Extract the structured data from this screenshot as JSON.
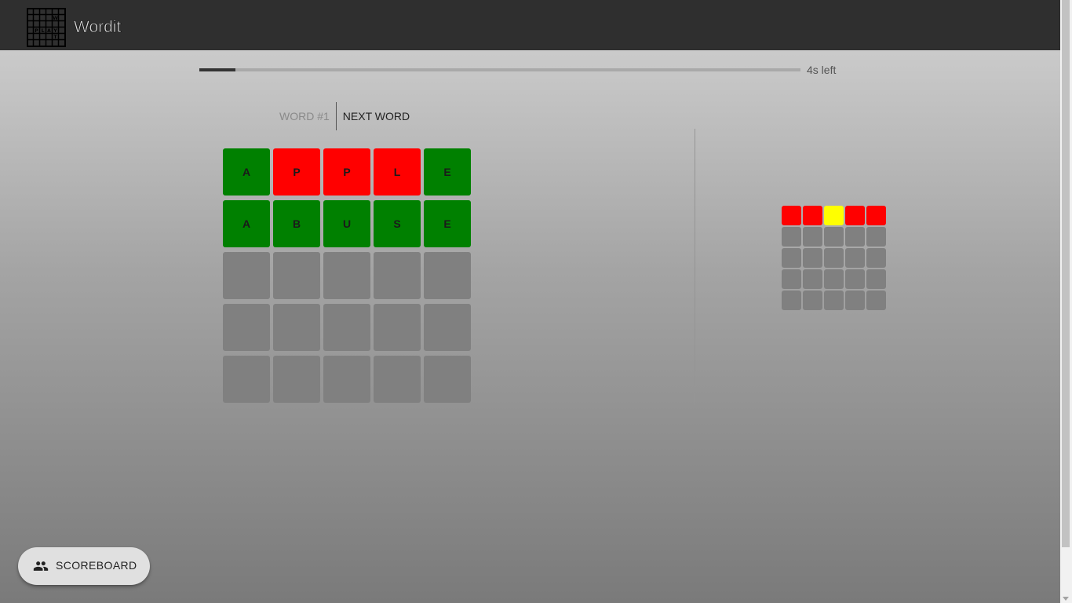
{
  "app": {
    "title": "Wordit",
    "logo_icon": "crossword-grid-logo-icon"
  },
  "timer": {
    "label": "4s left",
    "progress_fraction": 0.06
  },
  "tabs": {
    "current": "WORD #1",
    "next": "NEXT WORD"
  },
  "colors": {
    "green": "#008000",
    "red": "#ff0000",
    "yellow": "#ffff00",
    "gray": "#808080",
    "appbar": "#2f2f2f"
  },
  "board": {
    "rows": [
      [
        {
          "letter": "A",
          "state": "green"
        },
        {
          "letter": "P",
          "state": "red"
        },
        {
          "letter": "P",
          "state": "red"
        },
        {
          "letter": "L",
          "state": "red"
        },
        {
          "letter": "E",
          "state": "green"
        }
      ],
      [
        {
          "letter": "A",
          "state": "green"
        },
        {
          "letter": "B",
          "state": "green"
        },
        {
          "letter": "U",
          "state": "green"
        },
        {
          "letter": "S",
          "state": "green"
        },
        {
          "letter": "E",
          "state": "green"
        }
      ],
      [
        {
          "letter": "",
          "state": "gray"
        },
        {
          "letter": "",
          "state": "gray"
        },
        {
          "letter": "",
          "state": "gray"
        },
        {
          "letter": "",
          "state": "gray"
        },
        {
          "letter": "",
          "state": "gray"
        }
      ],
      [
        {
          "letter": "",
          "state": "gray"
        },
        {
          "letter": "",
          "state": "gray"
        },
        {
          "letter": "",
          "state": "gray"
        },
        {
          "letter": "",
          "state": "gray"
        },
        {
          "letter": "",
          "state": "gray"
        }
      ],
      [
        {
          "letter": "",
          "state": "gray"
        },
        {
          "letter": "",
          "state": "gray"
        },
        {
          "letter": "",
          "state": "gray"
        },
        {
          "letter": "",
          "state": "gray"
        },
        {
          "letter": "",
          "state": "gray"
        }
      ]
    ]
  },
  "opponent_board": {
    "rows": [
      [
        "red",
        "red",
        "yellow",
        "red",
        "red"
      ],
      [
        "gray",
        "gray",
        "gray",
        "gray",
        "gray"
      ],
      [
        "gray",
        "gray",
        "gray",
        "gray",
        "gray"
      ],
      [
        "gray",
        "gray",
        "gray",
        "gray",
        "gray"
      ],
      [
        "gray",
        "gray",
        "gray",
        "gray",
        "gray"
      ]
    ]
  },
  "scoreboard": {
    "label": "SCOREBOARD",
    "icon": "people-icon"
  }
}
